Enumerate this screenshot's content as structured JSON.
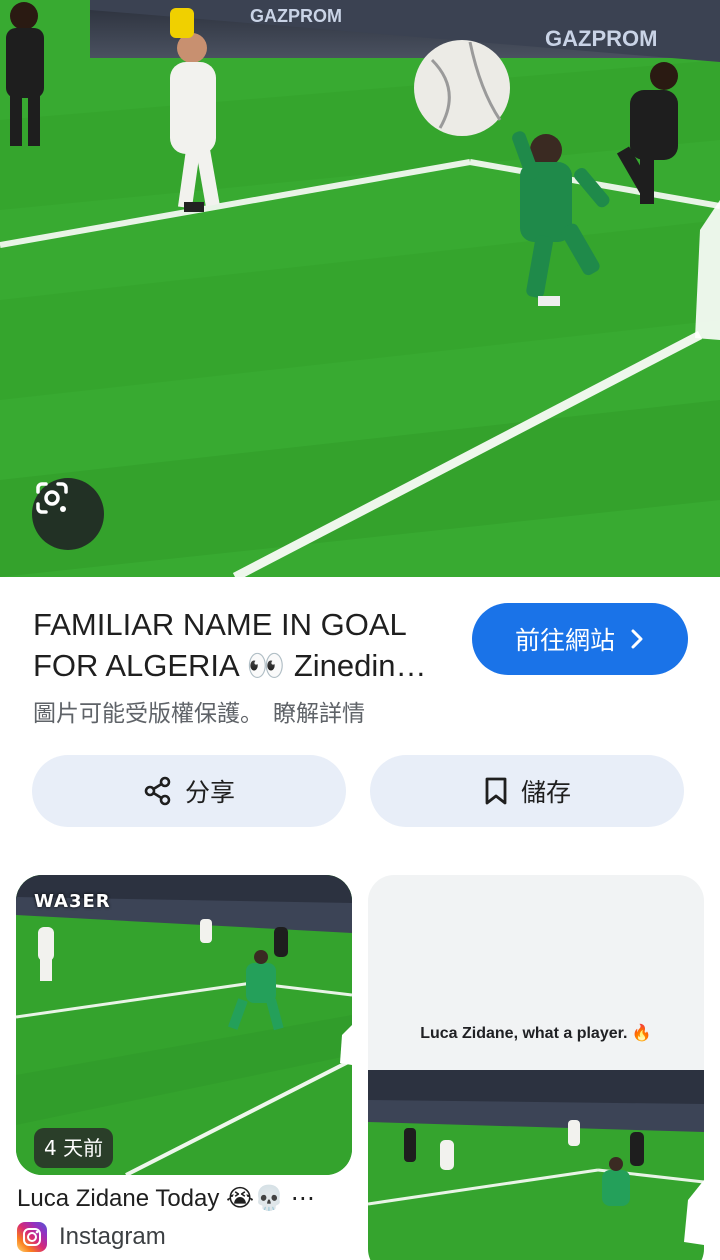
{
  "result": {
    "title": "FAMILIAR NAME IN GOAL FOR ALGERIA 👀 Zinedine Zidane's son Luca",
    "copyright_note": "圖片可能受版權保護。",
    "learn_more": "瞭解詳情",
    "visit_label": "前往網站",
    "share_label": "分享",
    "save_label": "儲存",
    "ad_board_text": "GAZPROM"
  },
  "related": [
    {
      "title": "Luca Zidane Today 😭💀 ⋯",
      "source": "Instagram",
      "time_badge": "4 天前",
      "watermark": "WA3ER"
    },
    {
      "caption": "Luca Zidane, what a player. 🔥"
    }
  ],
  "icons": {
    "lens": "google-lens-icon",
    "visit": "chevron-right-icon",
    "share": "share-icon",
    "save": "bookmark-icon",
    "source": "instagram-icon"
  },
  "colors": {
    "primary": "#1a73e8",
    "tonal_button": "#e8eef8",
    "pitch": "#36a82f",
    "goalkeeper_kit": "#1f8a4a"
  }
}
